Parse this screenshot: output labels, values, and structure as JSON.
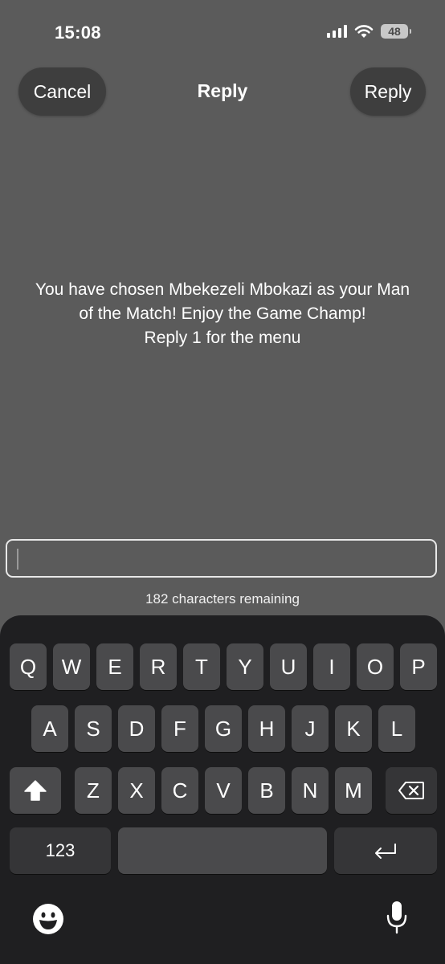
{
  "status_bar": {
    "time": "15:08",
    "battery_level": "48"
  },
  "nav": {
    "cancel_label": "Cancel",
    "title": "Reply",
    "reply_label": "Reply"
  },
  "message": {
    "lines": [
      "You have chosen Mbekezeli Mbokazi as your Man",
      "of the Match! Enjoy the Game Champ!",
      "Reply 1 for the menu"
    ]
  },
  "input": {
    "value": "",
    "counter_text": "182 characters remaining"
  },
  "keyboard": {
    "row1": [
      "Q",
      "W",
      "E",
      "R",
      "T",
      "Y",
      "U",
      "I",
      "O",
      "P"
    ],
    "row2": [
      "A",
      "S",
      "D",
      "F",
      "G",
      "H",
      "J",
      "K",
      "L"
    ],
    "row3": [
      "Z",
      "X",
      "C",
      "V",
      "B",
      "N",
      "M"
    ],
    "numbers_label": "123",
    "icons": {
      "shift": "shift-icon",
      "delete": "delete-icon",
      "return": "return-icon",
      "emoji": "emoji-icon",
      "dictation": "microphone-icon"
    }
  }
}
